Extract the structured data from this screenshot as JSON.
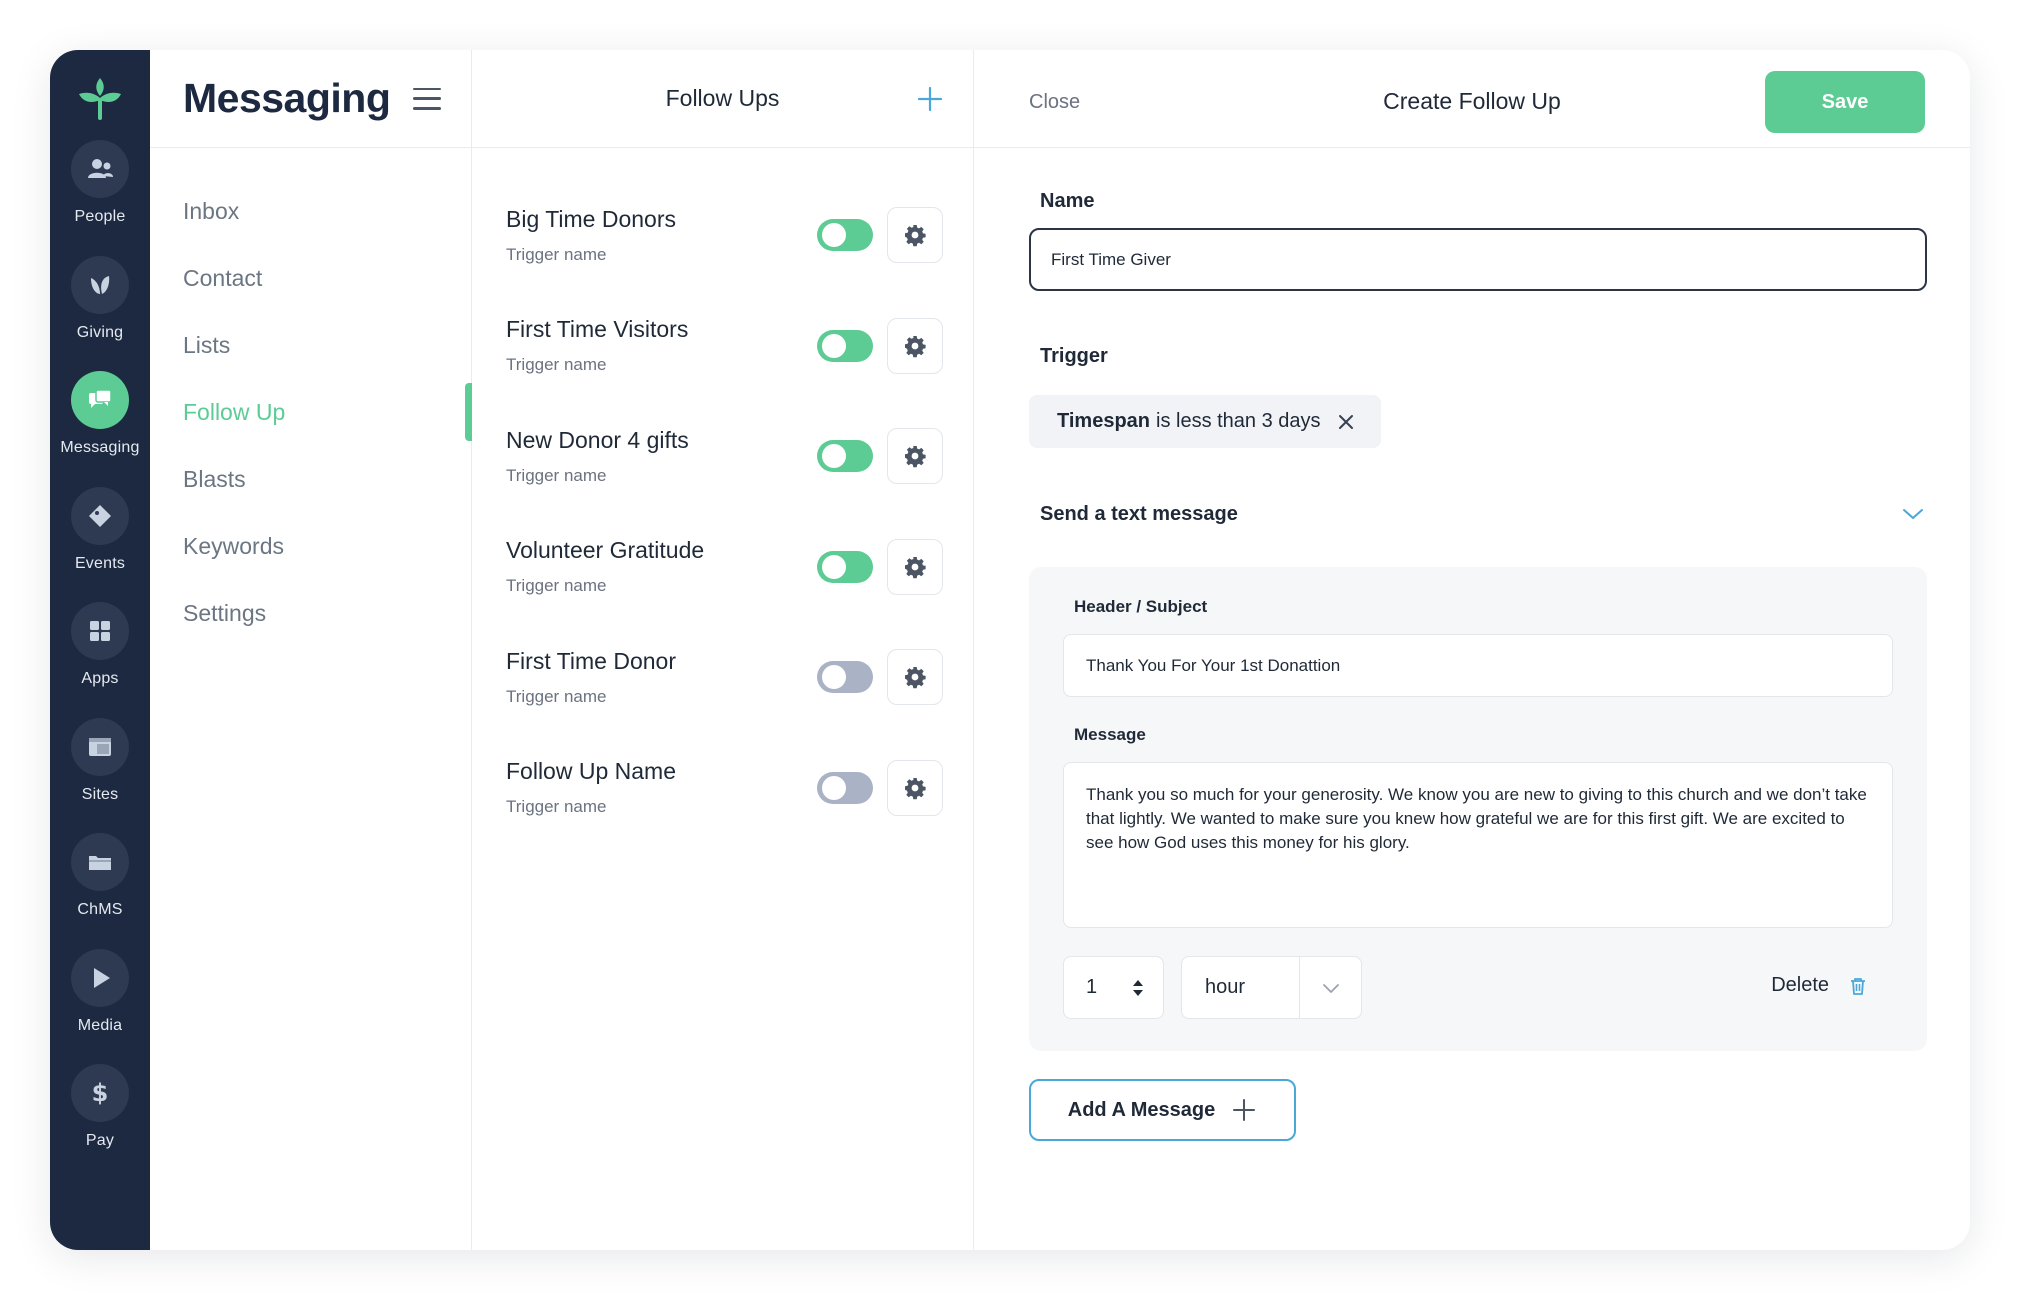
{
  "rail": {
    "items": [
      {
        "label": "People",
        "icon": "people-icon"
      },
      {
        "label": "Giving",
        "icon": "leaf-icon"
      },
      {
        "label": "Messaging",
        "icon": "chat-bubbles-icon"
      },
      {
        "label": "Events",
        "icon": "ticket-icon"
      },
      {
        "label": "Apps",
        "icon": "grid-icon"
      },
      {
        "label": "Sites",
        "icon": "layout-icon"
      },
      {
        "label": "ChMS",
        "icon": "folder-icon"
      },
      {
        "label": "Media",
        "icon": "play-icon"
      },
      {
        "label": "Pay",
        "icon": "dollar-icon"
      }
    ],
    "active": "Messaging"
  },
  "nav": {
    "title": "Messaging",
    "items": [
      "Inbox",
      "Contact",
      "Lists",
      "Follow Up",
      "Blasts",
      "Keywords",
      "Settings"
    ],
    "active": "Follow Up"
  },
  "list": {
    "title": "Follow Ups",
    "items": [
      {
        "name": "Big Time Donors",
        "sub": "Trigger name",
        "enabled": true
      },
      {
        "name": "First Time Visitors",
        "sub": "Trigger name",
        "enabled": true
      },
      {
        "name": "New Donor 4 gifts",
        "sub": "Trigger name",
        "enabled": true
      },
      {
        "name": "Volunteer Gratitude",
        "sub": "Trigger name",
        "enabled": true
      },
      {
        "name": "First Time Donor",
        "sub": "Trigger name",
        "enabled": false
      },
      {
        "name": "Follow Up Name",
        "sub": "Trigger name",
        "enabled": false
      }
    ]
  },
  "detail": {
    "close_label": "Close",
    "title": "Create Follow Up",
    "save_label": "Save",
    "name_label": "Name",
    "name_value": "First Time Giver",
    "trigger_label": "Trigger",
    "trigger_key": "Timespan",
    "trigger_rest": "is less than 3 days",
    "section_title": "Send a text message",
    "subject_label": "Header / Subject",
    "subject_value": "Thank You For Your 1st Donattion",
    "message_label": "Message",
    "message_value": "Thank you so much for your generosity. We know you are new to giving to this church and we don’t take that lightly. We wanted to make sure you knew how grateful we are for this first gift. We are excited to see how God uses this money for his glory.",
    "delay_amount": "1",
    "delay_unit": "hour",
    "delete_label": "Delete",
    "add_message_label": "Add A Message"
  },
  "colors": {
    "accent": "#5ccb94",
    "rail_bg": "#1c2940",
    "add_border": "#4aa8d8"
  }
}
